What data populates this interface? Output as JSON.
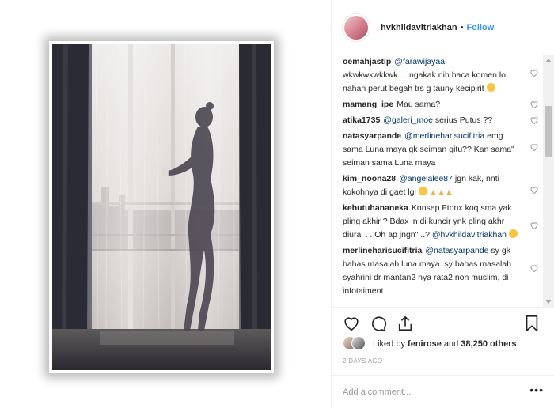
{
  "post": {
    "username": "hvkhildavitriakhan",
    "follow_label": "Follow",
    "separator": "•"
  },
  "comments": [
    {
      "user": "oemahjastip",
      "mention": "@farawijayaa",
      "text": " wkwkwkwkkwk.....ngakak nih baca komen lo, nahan perut begah trs g tauny kecipirit"
    },
    {
      "user": "mamang_ipe",
      "mention": "",
      "text": "Mau sama?"
    },
    {
      "user": "atika1735",
      "mention": "@galeri_moe",
      "text": " serius Putus ??"
    },
    {
      "user": "natasyarpande",
      "mention": "@merlineharisucifitria",
      "text": " emg sama Luna maya gk seiman gitu?? Kan sama\" seiman sama Luna maya"
    },
    {
      "user": "kim_noona28",
      "mention": "@angelalee87",
      "text": " jgn kak, nnti kokohnya di gaet lgi"
    },
    {
      "user": "kebutuhananeka",
      "mention": "",
      "text": "Konsep Ftonx koq sma yak pling akhir ? Bdax in di kuncir ynk pling akhr diurai . . Oh ap jngn\" ..?",
      "tail_mention": "@hvkhildavitriakhan"
    },
    {
      "user": "merlineharisucifitria",
      "mention": "@natasyarpande",
      "text": " sy gk bahas masalah luna maya..sy bahas masalah syahrini dr mantan2 nya rata2 non muslim, di infotaiment"
    }
  ],
  "icons": {
    "like": "heart-outline-icon",
    "comment": "speech-bubble-icon",
    "share": "share-upload-icon",
    "save": "bookmark-icon",
    "more": "ellipsis-icon"
  },
  "likes": {
    "prefix": "Liked by ",
    "first_user": "fenirose",
    "middle": " and ",
    "count": "38,250 others"
  },
  "date_label": "2 DAYS AGO",
  "add_comment": {
    "placeholder": "Add a comment...",
    "more_label": "•••"
  }
}
